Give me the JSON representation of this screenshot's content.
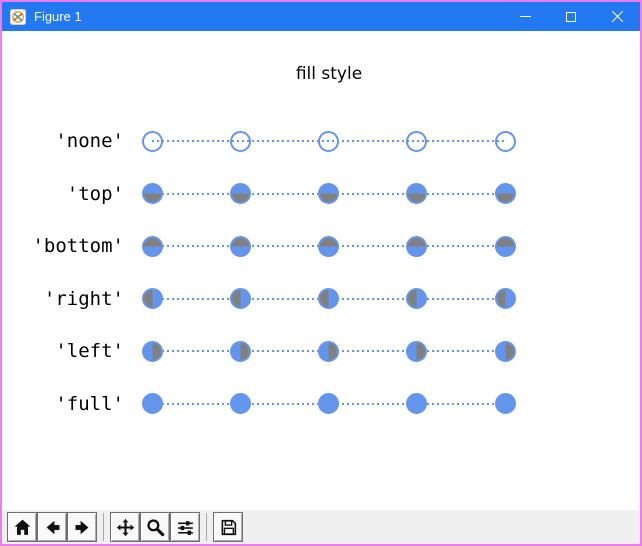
{
  "window": {
    "title": "Figure 1",
    "border_color": "#ee7bf0",
    "titlebar_color": "#2279f2",
    "controls": [
      {
        "name": "minimize"
      },
      {
        "name": "maximize"
      },
      {
        "name": "close"
      }
    ]
  },
  "chart_data": {
    "type": "line",
    "title": "fill style",
    "series": [
      {
        "label": "'none'",
        "fillstyle": "none",
        "points": 5
      },
      {
        "label": "'top'",
        "fillstyle": "top",
        "points": 5
      },
      {
        "label": "'bottom'",
        "fillstyle": "bottom",
        "points": 5
      },
      {
        "label": "'right'",
        "fillstyle": "right",
        "points": 5
      },
      {
        "label": "'left'",
        "fillstyle": "left",
        "points": 5
      },
      {
        "label": "'full'",
        "fillstyle": "full",
        "points": 5
      }
    ],
    "marker": "o",
    "linestyle": "dotted",
    "color": "#6495ED",
    "alt_color": "#808080",
    "axes_visible": false,
    "legend": false
  },
  "toolbar": {
    "items": [
      {
        "type": "button",
        "name": "home",
        "icon": "home-icon"
      },
      {
        "type": "button",
        "name": "back",
        "icon": "arrow-left-icon"
      },
      {
        "type": "button",
        "name": "forward",
        "icon": "arrow-right-icon"
      },
      {
        "type": "separator"
      },
      {
        "type": "button",
        "name": "pan",
        "icon": "move-cross-icon"
      },
      {
        "type": "button",
        "name": "zoom-to-rect",
        "icon": "magnifier-icon"
      },
      {
        "type": "button",
        "name": "configure-subplots",
        "icon": "sliders-icon"
      },
      {
        "type": "separator"
      },
      {
        "type": "button",
        "name": "save",
        "icon": "floppy-disk-icon"
      }
    ]
  }
}
